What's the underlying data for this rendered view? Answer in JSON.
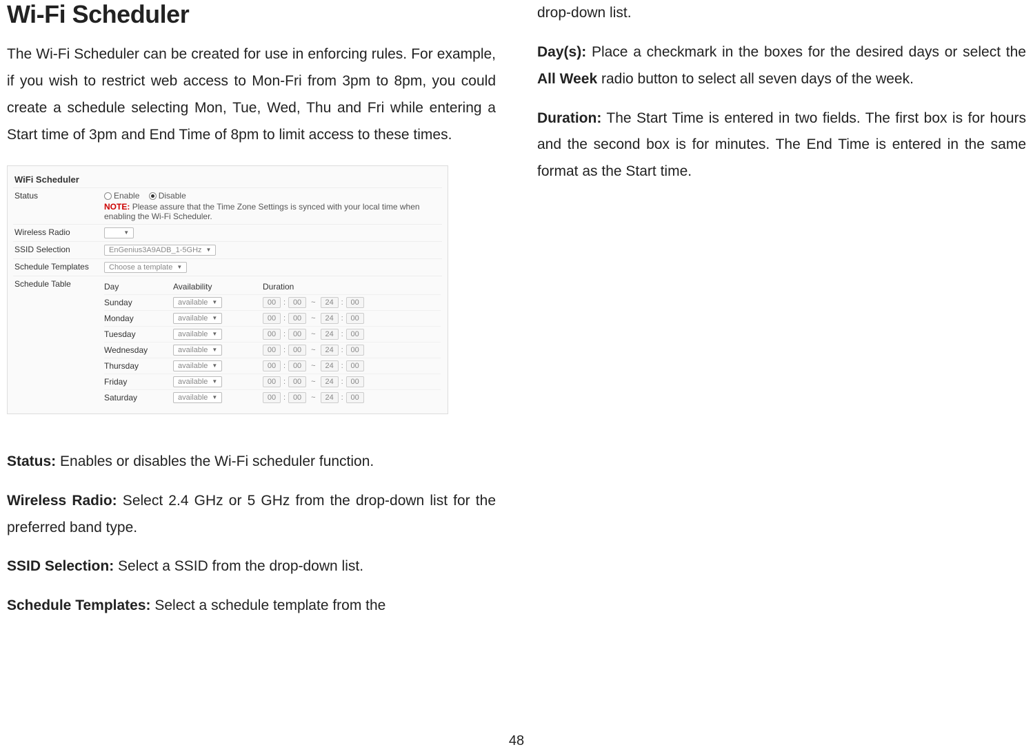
{
  "heading": "Wi-Fi Scheduler",
  "intro": "The Wi-Fi Scheduler can be created for use in enforcing rules. For example, if you wish to restrict web access to Mon-Fri from 3pm to 8pm, you could create a schedule selecting Mon, Tue, Wed, Thu and Fri while entering a Start time of 3pm and End Time of 8pm to limit access to these times.",
  "screenshot": {
    "panel_title": "WiFi Scheduler",
    "rows": {
      "status_label": "Status",
      "enable": "Enable",
      "disable": "Disable",
      "note_prefix": "NOTE:",
      "note_text": "Please assure that the Time Zone Settings is synced with your local time when enabling the Wi-Fi Scheduler.",
      "wireless_radio_label": "Wireless Radio",
      "ssid_label": "SSID Selection",
      "ssid_value": "EnGenius3A9ADB_1-5GHz",
      "template_label": "Schedule Templates",
      "template_value": "Choose a template",
      "table_label": "Schedule Table"
    },
    "table_head": {
      "day": "Day",
      "availability": "Availability",
      "duration": "Duration"
    },
    "days": [
      {
        "name": "Sunday",
        "avail": "available",
        "sh": "00",
        "sm": "00",
        "eh": "24",
        "em": "00"
      },
      {
        "name": "Monday",
        "avail": "available",
        "sh": "00",
        "sm": "00",
        "eh": "24",
        "em": "00"
      },
      {
        "name": "Tuesday",
        "avail": "available",
        "sh": "00",
        "sm": "00",
        "eh": "24",
        "em": "00"
      },
      {
        "name": "Wednesday",
        "avail": "available",
        "sh": "00",
        "sm": "00",
        "eh": "24",
        "em": "00"
      },
      {
        "name": "Thursday",
        "avail": "available",
        "sh": "00",
        "sm": "00",
        "eh": "24",
        "em": "00"
      },
      {
        "name": "Friday",
        "avail": "available",
        "sh": "00",
        "sm": "00",
        "eh": "24",
        "em": "00"
      },
      {
        "name": "Saturday",
        "avail": "available",
        "sh": "00",
        "sm": "00",
        "eh": "24",
        "em": "00"
      }
    ]
  },
  "defs": {
    "status": {
      "term": "Status:",
      "text": " Enables or disables the Wi-Fi scheduler function."
    },
    "wireless_radio": {
      "term": "Wireless Radio:",
      "text": " Select 2.4 GHz or 5 GHz from the drop-down list for the preferred band type."
    },
    "ssid": {
      "term": "SSID Selection:",
      "text": " Select a SSID from the drop-down list."
    },
    "templates": {
      "term": "Schedule Templates:",
      "text": " Select a schedule template from the "
    },
    "dropdown_cont": "drop-down list.",
    "days": {
      "term": "Day(s):",
      "pre": " Place a checkmark in the boxes for the desired days or select the ",
      "bold": "All Week",
      "post": " radio button to select all seven days of the week."
    },
    "duration": {
      "term": "Duration:",
      "text": " The Start Time is entered in two fields. The first box is for hours and the second box is for minutes. The End Time is entered in the same format as the Start time."
    }
  },
  "page_number": "48"
}
